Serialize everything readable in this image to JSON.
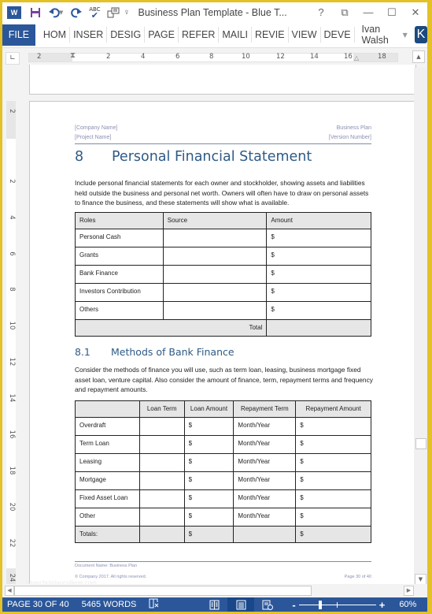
{
  "titlebar": {
    "title": "Business Plan Template - Blue T...",
    "help": "?",
    "ribbon_display": "⧉",
    "minimize": "—",
    "maximize": "☐",
    "close": "✕",
    "app_icon": "W",
    "icons": [
      "word-logo-icon",
      "save-icon",
      "undo-icon",
      "redo-icon",
      "spelling-icon",
      "touch-mode-icon",
      "customize-qat-icon"
    ]
  },
  "ribbon": {
    "file": "FILE",
    "tabs": [
      "HOM",
      "INSER",
      "DESIG",
      "PAGE",
      "REFER",
      "MAILI",
      "REVIE",
      "VIEW",
      "DEVE"
    ],
    "user_name": "Ivan Walsh",
    "user_initial": "K"
  },
  "ruler": {
    "h_numbers": [
      "2",
      "2",
      "4",
      "6",
      "8",
      "10",
      "12",
      "14",
      "16",
      "18"
    ],
    "v_numbers": [
      "2",
      "2",
      "4",
      "6",
      "8",
      "10",
      "12",
      "14",
      "16",
      "18",
      "20",
      "22",
      "24"
    ]
  },
  "page": {
    "header": {
      "company": "[Company Name]",
      "project": "[Project Name]",
      "doc_type": "Business Plan",
      "version": "[Version Number]"
    },
    "section": {
      "number": "8",
      "title": "Personal Financial Statement",
      "body": "Include personal financial statements for each owner and stockholder, showing assets and liabilities held outside the business and personal net worth. Owners will often have to draw on personal assets to finance the business, and these statements will show what is available."
    },
    "table1": {
      "headers": [
        "Roles",
        "Source",
        "Amount"
      ],
      "rows": [
        [
          "Personal Cash",
          "",
          "$"
        ],
        [
          "Grants",
          "",
          "$"
        ],
        [
          "Bank Finance",
          "",
          "$"
        ],
        [
          "Investors Contribution",
          "",
          "$"
        ],
        [
          "Others",
          "",
          "$"
        ]
      ],
      "total_label": "Total",
      "total_value": ""
    },
    "subsection": {
      "number": "8.1",
      "title": "Methods of Bank Finance",
      "body": "Consider the methods of finance you will use, such as term loan, leasing, business mortgage fixed asset loan, venture capital. Also consider the amount of finance, term, repayment terms and frequency and repayment amounts."
    },
    "table2": {
      "headers": [
        "",
        "Loan Term",
        "Loan Amount",
        "Repayment Term",
        "Repayment Amount"
      ],
      "rows": [
        [
          "Overdraft",
          "",
          "$",
          "Month/Year",
          "$"
        ],
        [
          "Term Loan",
          "",
          "$",
          "Month/Year",
          "$"
        ],
        [
          "Leasing",
          "",
          "$",
          "Month/Year",
          "$"
        ],
        [
          "Mortgage",
          "",
          "$",
          "Month/Year",
          "$"
        ],
        [
          "Fixed Asset Loan",
          "",
          "$",
          "Month/Year",
          "$"
        ],
        [
          "Other",
          "",
          "$",
          "Month/Year",
          "$"
        ]
      ],
      "totals": [
        "Totals:",
        "",
        "$",
        "",
        "$"
      ]
    },
    "footer": {
      "doc_name": "Document Name: Business Plan",
      "copyright": "© Company 2017. All rights reserved.",
      "page": "Page 30 of 40"
    },
    "watermark": "itagechristiancollege.com"
  },
  "statusbar": {
    "page": "PAGE 30 OF 40",
    "words": "5465 WORDS",
    "proofing_icon": "📖",
    "zoom_minus": "-",
    "zoom_plus": "+",
    "zoom_percent": "60%",
    "zoom_value": 60,
    "active_view": "print-layout"
  },
  "scroll": {
    "up": "▲",
    "down": "▼",
    "left": "◀",
    "right": "▶"
  }
}
